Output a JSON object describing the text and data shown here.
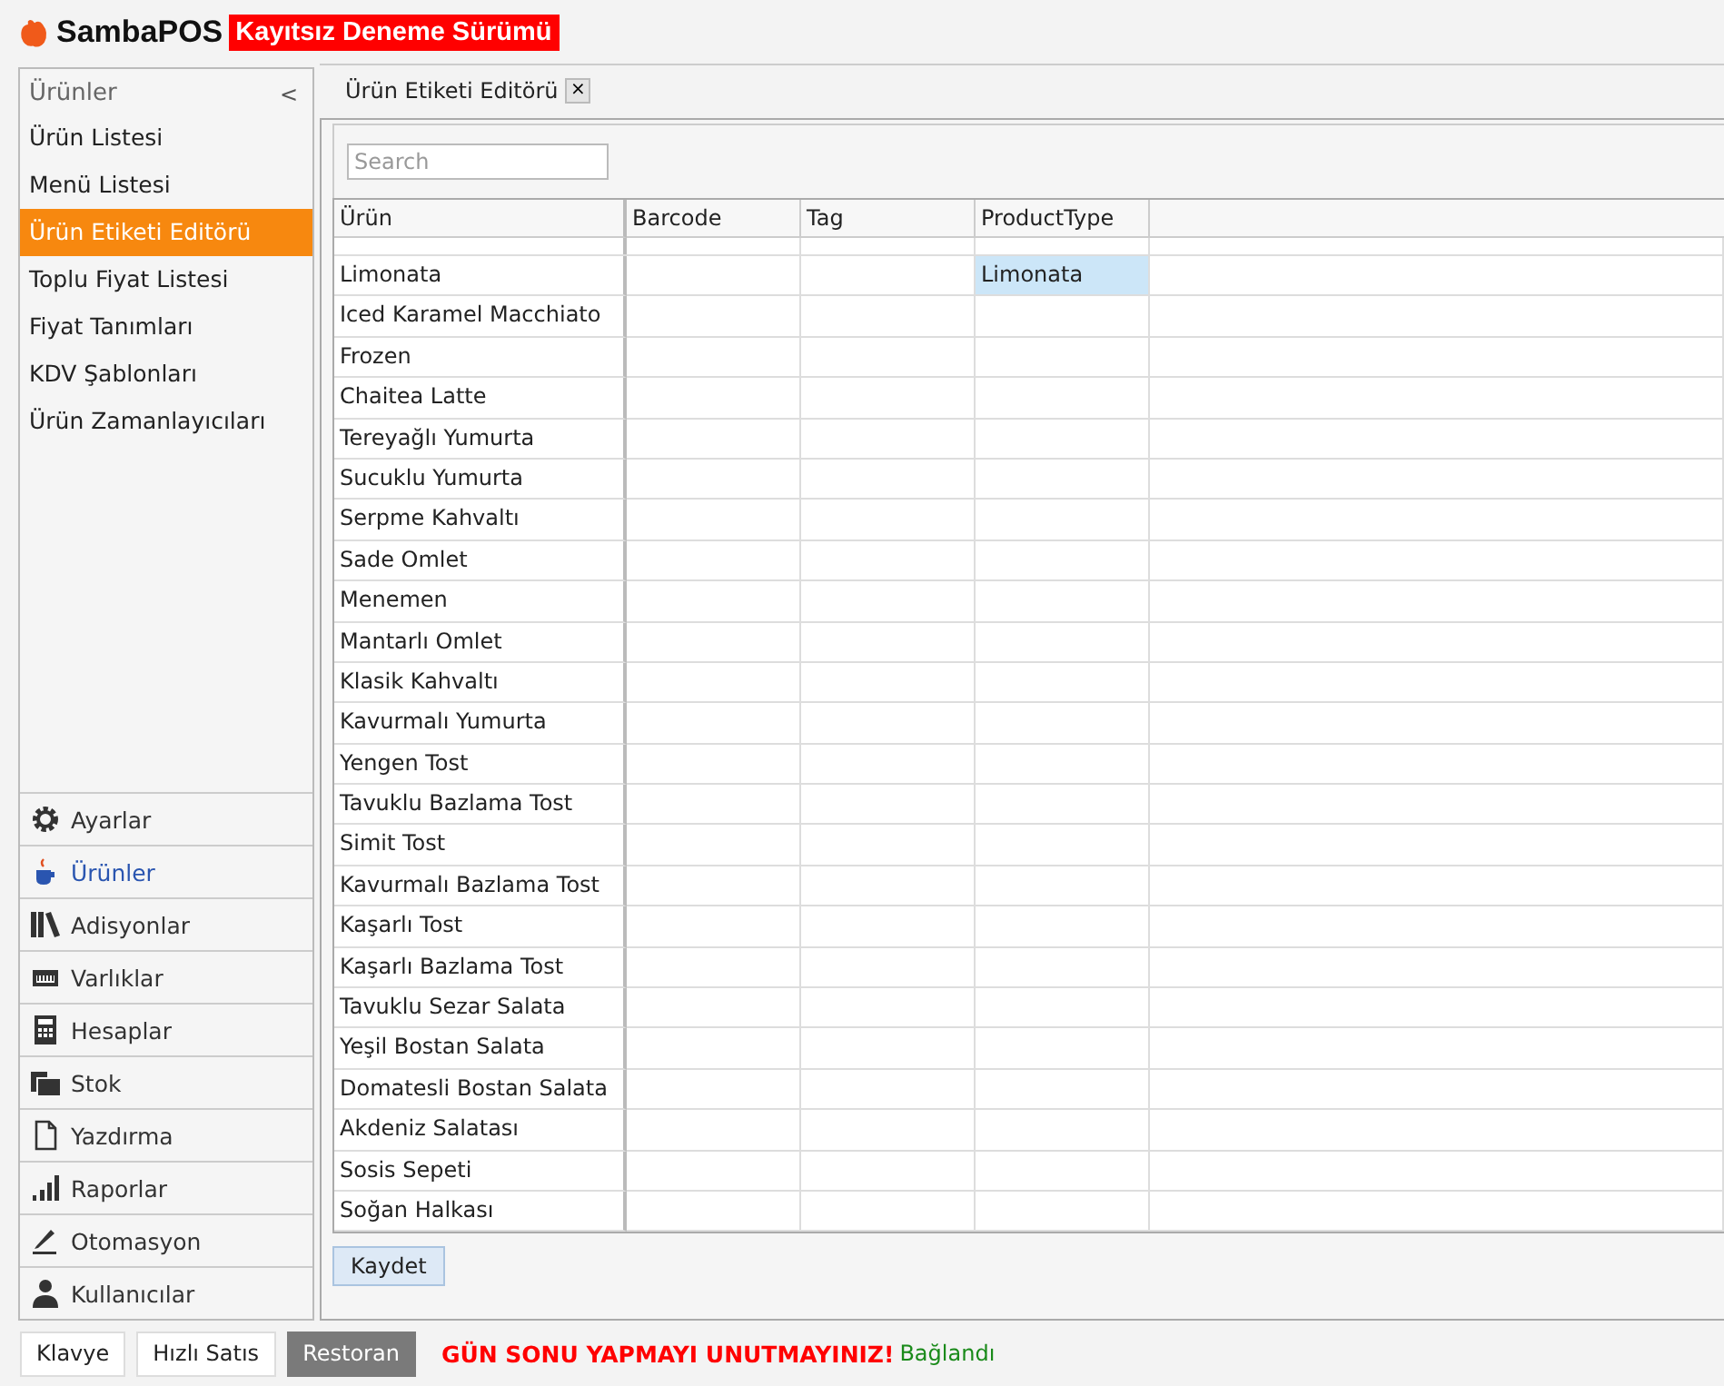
{
  "app": {
    "name": "SambaPOS",
    "badge": "Kayıtsız Deneme Sürümü"
  },
  "sidebar": {
    "title": "Ürünler",
    "collapse": "<",
    "items": [
      {
        "label": "Ürün Listesi",
        "selected": false
      },
      {
        "label": "Menü Listesi",
        "selected": false
      },
      {
        "label": "Ürün Etiketi Editörü",
        "selected": true
      },
      {
        "label": "Toplu Fiyat Listesi",
        "selected": false
      },
      {
        "label": "Fiyat Tanımları",
        "selected": false
      },
      {
        "label": "KDV Şablonları",
        "selected": false
      },
      {
        "label": "Ürün Zamanlayıcıları",
        "selected": false
      }
    ],
    "sections": [
      {
        "label": "Ayarlar",
        "kind": "gear",
        "selected": false
      },
      {
        "label": "Ürünler",
        "kind": "cup",
        "selected": true
      },
      {
        "label": "Adisyonlar",
        "kind": "books",
        "selected": false
      },
      {
        "label": "Varlıklar",
        "kind": "ruler",
        "selected": false
      },
      {
        "label": "Hesaplar",
        "kind": "calculator",
        "selected": false
      },
      {
        "label": "Stok",
        "kind": "boxes",
        "selected": false
      },
      {
        "label": "Yazdırma",
        "kind": "document",
        "selected": false
      },
      {
        "label": "Raporlar",
        "kind": "bars",
        "selected": false
      },
      {
        "label": "Otomasyon",
        "kind": "pen",
        "selected": false
      },
      {
        "label": "Kullanıcılar",
        "kind": "user",
        "selected": false
      }
    ]
  },
  "tab": {
    "label": "Ürün Etiketi Editörü",
    "close": "×"
  },
  "search": {
    "placeholder": "Search"
  },
  "table": {
    "columns": [
      "Ürün",
      "Barcode",
      "Tag",
      "ProductType"
    ],
    "rows": [
      {
        "name": "Limonata",
        "product_type": "Limonata",
        "selected": true
      },
      {
        "name": "Iced Karamel Macchiato",
        "selected": false
      },
      {
        "name": "Frozen",
        "selected": false
      },
      {
        "name": "Chaitea Latte",
        "selected": false
      },
      {
        "name": "Tereyağlı Yumurta",
        "selected": false
      },
      {
        "name": "Sucuklu Yumurta",
        "selected": false
      },
      {
        "name": "Serpme Kahvaltı",
        "selected": false
      },
      {
        "name": "Sade Omlet",
        "selected": false
      },
      {
        "name": "Menemen",
        "selected": false
      },
      {
        "name": "Mantarlı Omlet",
        "selected": false
      },
      {
        "name": "Klasik Kahvaltı",
        "selected": false
      },
      {
        "name": "Kavurmalı Yumurta",
        "selected": false
      },
      {
        "name": "Yengen Tost",
        "selected": false
      },
      {
        "name": "Tavuklu Bazlama Tost",
        "selected": false
      },
      {
        "name": "Simit Tost",
        "selected": false
      },
      {
        "name": "Kavurmalı Bazlama Tost",
        "selected": false
      },
      {
        "name": "Kaşarlı Tost",
        "selected": false
      },
      {
        "name": "Kaşarlı Bazlama Tost",
        "selected": false
      },
      {
        "name": "Tavuklu Sezar Salata",
        "selected": false
      },
      {
        "name": "Yeşil Bostan Salata",
        "selected": false
      },
      {
        "name": "Domatesli Bostan Salata",
        "selected": false
      },
      {
        "name": "Akdeniz Salatası",
        "selected": false
      },
      {
        "name": "Sosis Sepeti",
        "selected": false
      },
      {
        "name": "Soğan Halkası",
        "selected": false
      }
    ]
  },
  "save_button": "Kaydet",
  "status_bar": {
    "buttons": [
      {
        "label": "Klavye",
        "selected": false
      },
      {
        "label": "Hızlı Satıs",
        "selected": false
      },
      {
        "label": "Restoran",
        "selected": true
      }
    ],
    "warning": "GÜN SONU YAPMAYI UNUTMAYINIZ!",
    "connection": "Bağlandı"
  }
}
